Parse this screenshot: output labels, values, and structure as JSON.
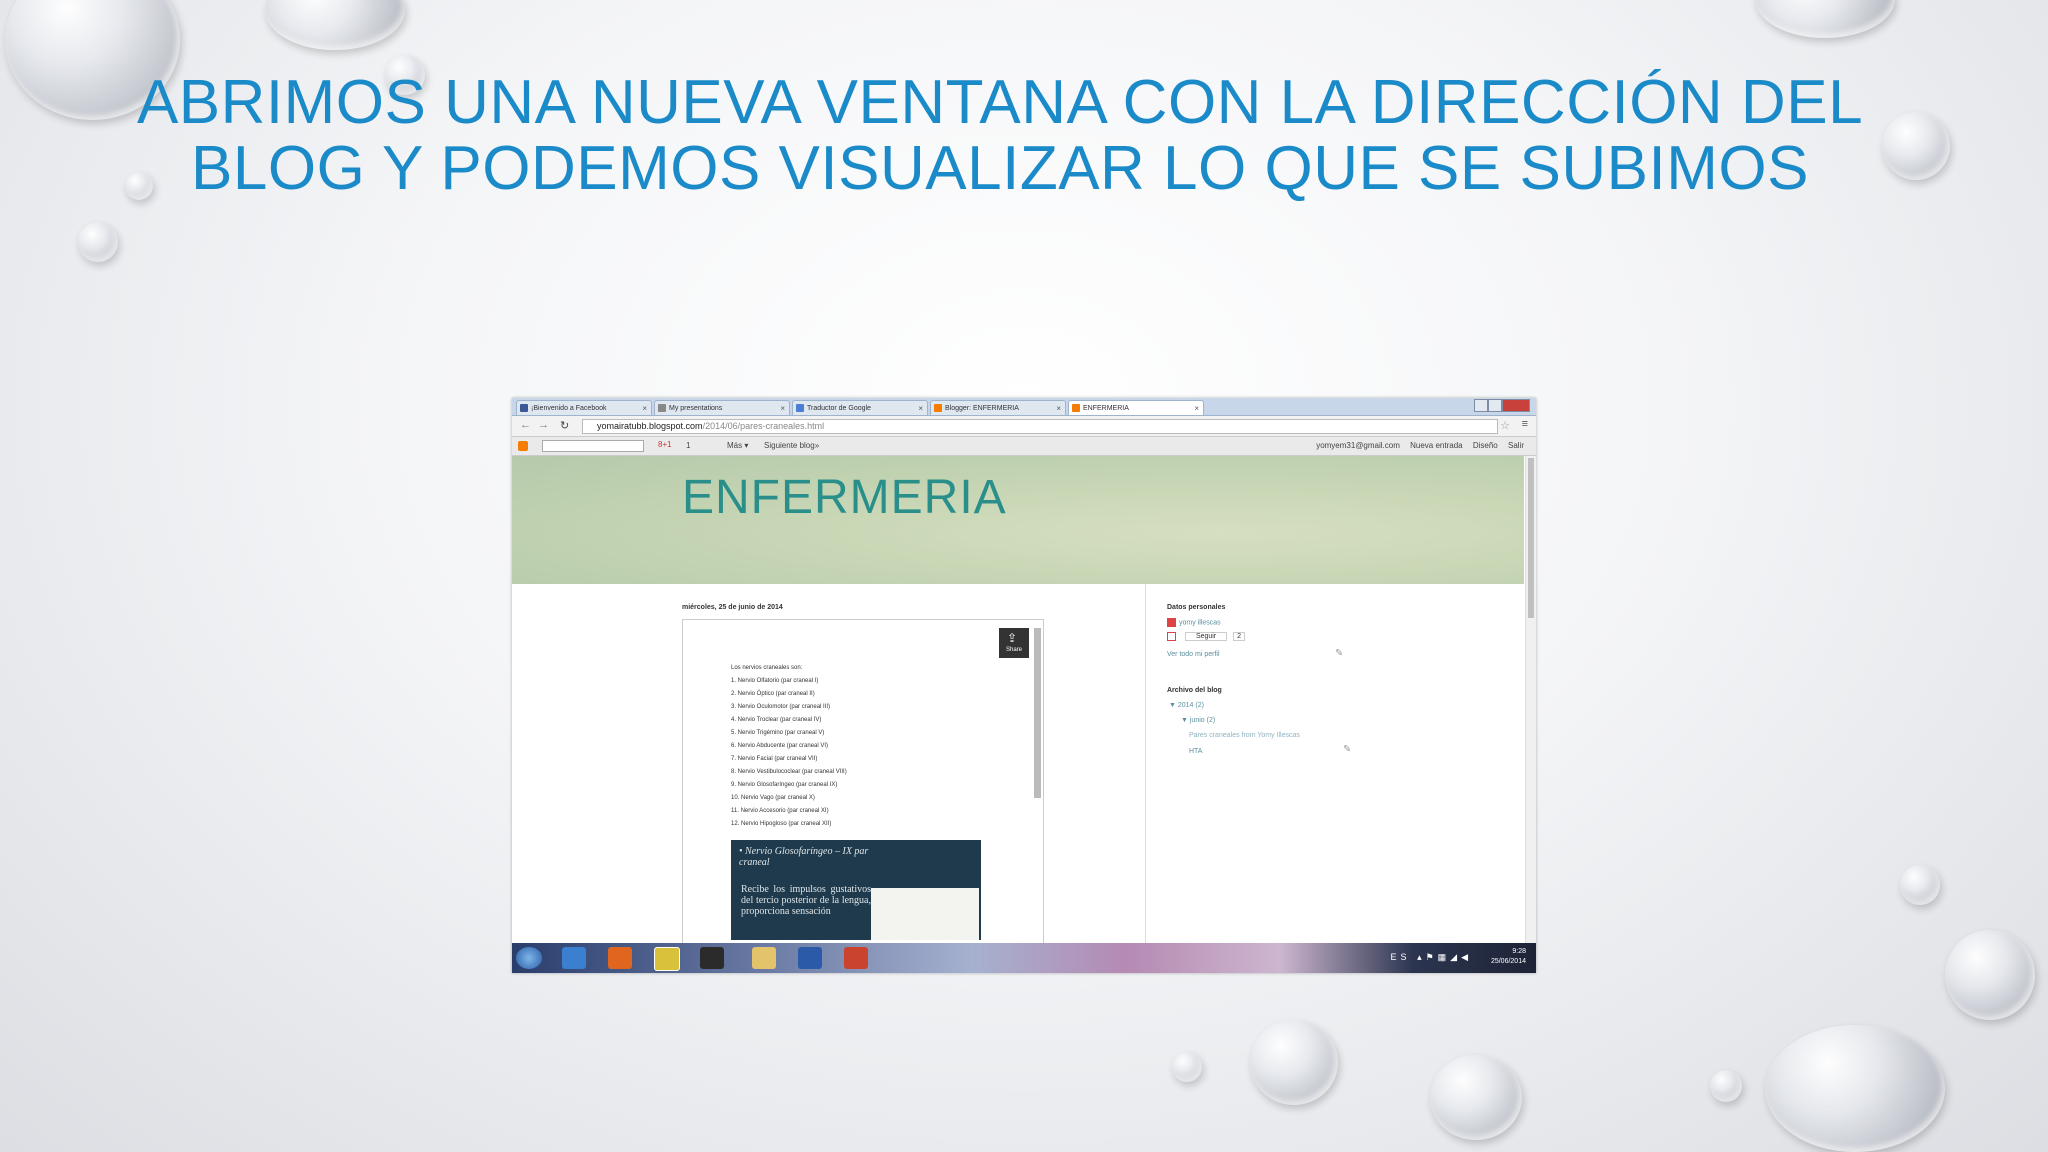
{
  "slide": {
    "title_line1": "ABRIMOS UNA NUEVA VENTANA CON LA DIRECCIÓN DEL",
    "title_line2": "BLOG Y PODEMOS VISUALIZAR LO QUE SE SUBIMOS"
  },
  "browser": {
    "tabs": [
      {
        "label": "¡Bienvenido a Facebook",
        "icon": "facebook-icon",
        "color": "#3b5998"
      },
      {
        "label": "My presentations",
        "icon": "document-icon",
        "color": "#888888"
      },
      {
        "label": "Traductor de Google",
        "icon": "translate-icon",
        "color": "#4a7fd4"
      },
      {
        "label": "Blogger: ENFERMERIA",
        "icon": "blogger-icon",
        "color": "#f57d00"
      },
      {
        "label": "ENFERMERIA",
        "icon": "blogger-icon",
        "color": "#f57d00"
      }
    ],
    "url_domain": "yomairatubb.blogspot.com",
    "url_path": "/2014/06/pares-craneales.html"
  },
  "bloggerbar": {
    "gplus": "8+1",
    "count": "1",
    "more": "Más ▾",
    "follow": "Siguiente blog»",
    "email": "yomyem31@gmail.com",
    "new_post": "Nueva entrada",
    "design": "Diseño",
    "logout": "Salir"
  },
  "blog": {
    "title": "ENFERMERIA",
    "post_date": "miércoles, 25 de junio de 2014",
    "share": "Share",
    "list_intro": "Los nervios craneales son:",
    "nerves": [
      "1. Nervio Olfatorio (par craneal I)",
      "2. Nervio Óptico (par craneal II)",
      "3. Nervio Oculomotor (par craneal III)",
      "4. Nervio Troclear (par craneal IV)",
      "5. Nervio Trigémino (par craneal V)",
      "6. Nervio Abducente (par craneal VI)",
      "7. Nervio Facial (par craneal VII)",
      "8. Nervio Vestibulococlear (par craneal VIII)",
      "9. Nervio Glosofaríngeo (par craneal IX)",
      "10. Nervio Vago (par craneal X)",
      "11. Nervio Accesorio (par craneal XI)",
      "12. Nervio Hipogloso (par craneal XII)"
    ],
    "slide_title": "• Nervio Glosofaríngeo – IX par craneal",
    "slide_body": "Recibe los impulsos gustativos del tercio posterior de la lengua, proporciona sensación"
  },
  "sidebar": {
    "profile_heading": "Datos personales",
    "profile_name": "yomy illescas",
    "follow_btn": "Seguir",
    "follow_count": "2",
    "view_profile": "Ver todo mi perfil",
    "archive_heading": "Archivo del blog",
    "year": "▼ 2014 (2)",
    "month": "▼ junio (2)",
    "post1": "Pares craneales from Yomy Illescas",
    "post2": "HTA"
  },
  "taskbar": {
    "lang": "ES",
    "time": "9:28",
    "date": "25/06/2014"
  }
}
